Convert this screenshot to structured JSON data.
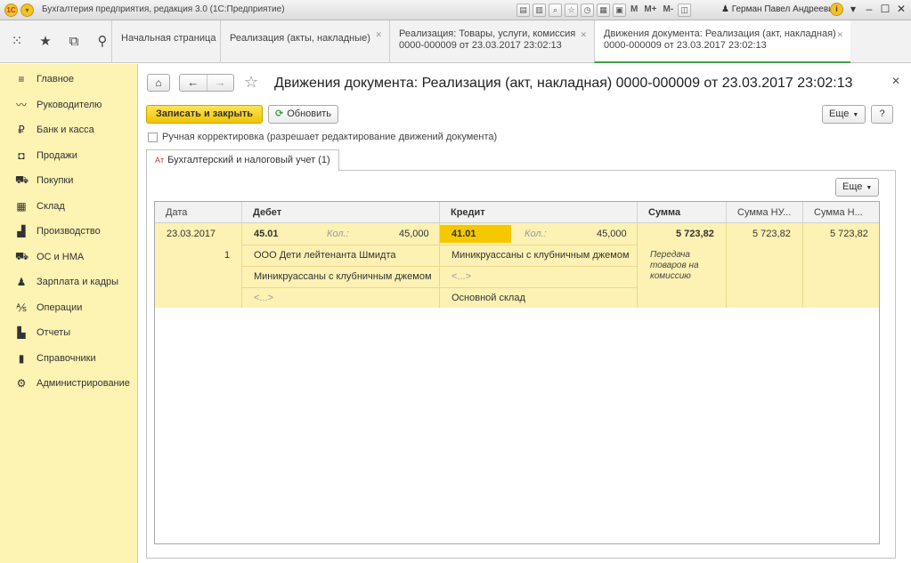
{
  "window": {
    "title": "Бухгалтерия предприятия, редакция 3.0  (1С:Предприятие)",
    "user": "Герман Павел Андреевич",
    "logo": "1С",
    "toolbar_letters": [
      "M",
      "M+",
      "M-"
    ]
  },
  "tabs": [
    {
      "label": "Начальная страница",
      "closable": false
    },
    {
      "label": "Реализация (акты, накладные)",
      "closable": true
    },
    {
      "label": "Реализация: Товары, услуги, комиссия",
      "sub": "0000-000009 от 23.03.2017 23:02:13",
      "closable": true
    },
    {
      "label": "Движения документа: Реализация (акт, накладная)",
      "sub": "0000-000009 от 23.03.2017 23:02:13",
      "closable": true,
      "active": true
    }
  ],
  "sidebar": {
    "items": [
      {
        "label": "Главное",
        "icon": "menu-lines-icon"
      },
      {
        "label": "Руководителю",
        "icon": "trend-icon"
      },
      {
        "label": "Банк и касса",
        "icon": "ruble-icon"
      },
      {
        "label": "Продажи",
        "icon": "bag-icon"
      },
      {
        "label": "Покупки",
        "icon": "cart-icon"
      },
      {
        "label": "Склад",
        "icon": "warehouse-icon"
      },
      {
        "label": "Производство",
        "icon": "factory-icon"
      },
      {
        "label": "ОС и НМА",
        "icon": "truck-icon"
      },
      {
        "label": "Зарплата и кадры",
        "icon": "person-icon"
      },
      {
        "label": "Операции",
        "icon": "operations-icon"
      },
      {
        "label": "Отчеты",
        "icon": "bar-chart-icon"
      },
      {
        "label": "Справочники",
        "icon": "books-icon"
      },
      {
        "label": "Администрирование",
        "icon": "gear-icon"
      }
    ]
  },
  "form": {
    "title": "Движения документа: Реализация (акт, накладная) 0000-000009 от 23.03.2017 23:02:13",
    "save_close": "Записать и закрыть",
    "refresh": "Обновить",
    "more": "Еще",
    "help": "?",
    "manual_edit": "Ручная корректировка (разрешает редактирование движений документа)",
    "tab_label": "Бухгалтерский и налоговый учет (1)"
  },
  "grid": {
    "columns": [
      "Дата",
      "Дебет",
      "Кредит",
      "Сумма",
      "Сумма НУ...",
      "Сумма Н..."
    ],
    "row": {
      "date": "23.03.2017",
      "num": "1",
      "debit_account": "45.01",
      "qty_label": "Кол.:",
      "debit_qty": "45,000",
      "debit_sub1": "ООО Дети лейтенанта Шмидта",
      "debit_sub2": "Миникруассаны с клубничным джемом",
      "debit_sub3": "<...>",
      "credit_account": "41.01",
      "credit_qty": "45,000",
      "credit_sub1": "Миникруассаны с клубничным джемом",
      "credit_sub2": "<...>",
      "credit_sub3": "Основной склад",
      "sum": "5 723,82",
      "sum_nu": "5 723,82",
      "sum_n": "5 723,82",
      "content": "Передача товаров на комиссию"
    }
  }
}
